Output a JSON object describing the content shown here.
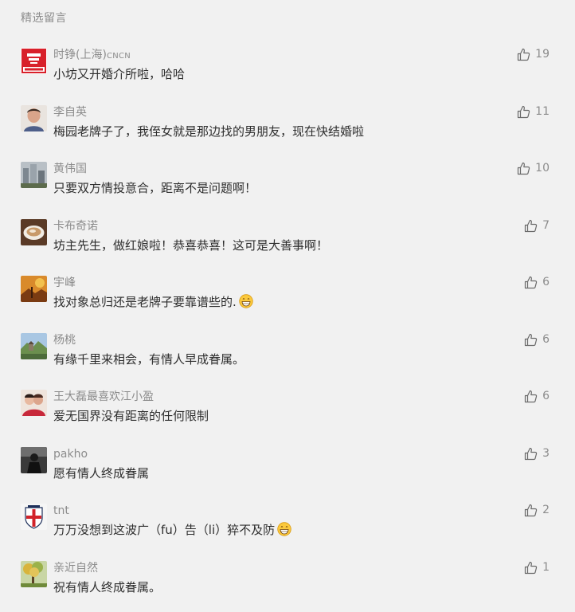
{
  "section": {
    "title": "精选留言"
  },
  "comments": [
    {
      "nickname": "时铮(上海)",
      "nickname_suffix": "CNCN",
      "text": "小坊又开婚介所啦，哈哈",
      "likes": "19",
      "avatar": "red-logo-avatar",
      "emoji": false
    },
    {
      "nickname": "李自英",
      "text": "梅园老牌子了，我侄女就是那边找的男朋友，现在快结婚啦",
      "likes": "11",
      "avatar": "portrait-avatar",
      "emoji": false
    },
    {
      "nickname": "黄伟国",
      "text": "只要双方情投意合，距离不是问题啊！",
      "likes": "10",
      "avatar": "buildings-avatar",
      "emoji": false
    },
    {
      "nickname": "卡布奇诺",
      "text": "坊主先生，做红娘啦！恭喜恭喜！这可是大善事啊！",
      "likes": "7",
      "avatar": "coffee-avatar",
      "emoji": false
    },
    {
      "nickname": "宇峰",
      "text": "找对象总归还是老牌子要靠谱些的.",
      "likes": "6",
      "avatar": "autumn-avatar",
      "emoji": true
    },
    {
      "nickname": "杨桃",
      "text": "有缘千里来相会，有情人早成眷属。",
      "likes": "6",
      "avatar": "landscape-avatar",
      "emoji": false
    },
    {
      "nickname": "王大磊最喜欢江小盈",
      "text": "爱无国界没有距离的任何限制",
      "likes": "6",
      "avatar": "couple-avatar",
      "emoji": false
    },
    {
      "nickname": "pakho",
      "text": "愿有情人终成眷属",
      "likes": "3",
      "avatar": "dark-figure-avatar",
      "emoji": false
    },
    {
      "nickname": "tnt",
      "text": "万万没想到这波广（fu）告（li）猝不及防",
      "likes": "2",
      "avatar": "badge-avatar",
      "emoji": true
    },
    {
      "nickname": "亲近自然",
      "text": "祝有情人终成眷属。",
      "likes": "1",
      "avatar": "tree-avatar",
      "emoji": false
    }
  ],
  "colors": {
    "muted": "#8c8c8c",
    "text": "#2e2e2e",
    "background": "#f1f1f1"
  },
  "icons": {
    "like": "thumbs-up-icon",
    "emoji": "grin-emoji-icon"
  }
}
